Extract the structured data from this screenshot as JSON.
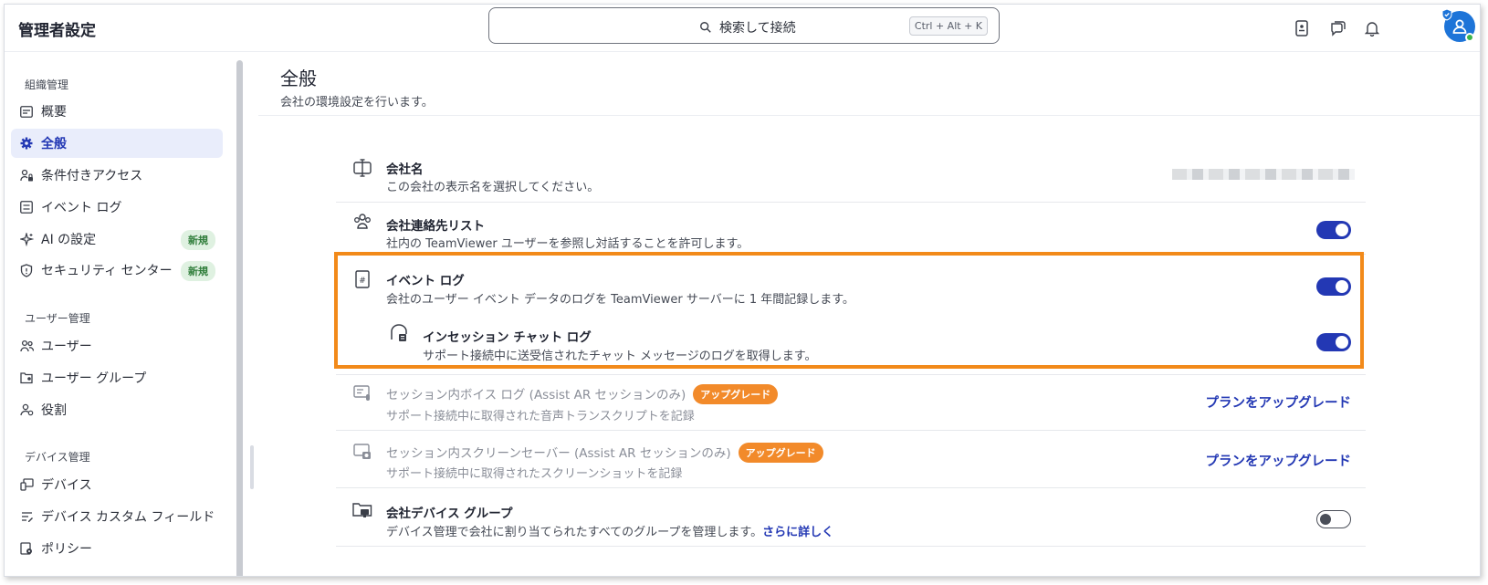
{
  "header": {
    "title": "管理者設定",
    "search_label": "検索して接続",
    "shortcut": "Ctrl + Alt + K"
  },
  "sidebar": {
    "sections": [
      {
        "label": "組織管理",
        "items": [
          {
            "label": "概要",
            "icon": "dashboard-icon"
          },
          {
            "label": "全般",
            "icon": "gear-icon",
            "active": true
          },
          {
            "label": "条件付きアクセス",
            "icon": "conditional-access-icon"
          },
          {
            "label": "イベント ログ",
            "icon": "log-icon"
          },
          {
            "label": "AI の設定",
            "icon": "sparkle-icon",
            "badge": "新規"
          },
          {
            "label": "セキュリティ センター",
            "icon": "shield-icon",
            "badge": "新規"
          }
        ]
      },
      {
        "label": "ユーザー管理",
        "items": [
          {
            "label": "ユーザー",
            "icon": "users-icon"
          },
          {
            "label": "ユーザー グループ",
            "icon": "user-group-icon"
          },
          {
            "label": "役割",
            "icon": "role-icon"
          }
        ]
      },
      {
        "label": "デバイス管理",
        "items": [
          {
            "label": "デバイス",
            "icon": "devices-icon"
          },
          {
            "label": "デバイス カスタム フィールド",
            "icon": "custom-field-icon"
          },
          {
            "label": "ポリシー",
            "icon": "policy-icon"
          }
        ]
      }
    ]
  },
  "main": {
    "title": "全般",
    "subtitle": "会社の環境設定を行います。",
    "settings": [
      {
        "title": "会社名",
        "desc": "この会社の表示名を選択してください。",
        "icon": "company-name-icon"
      },
      {
        "title": "会社連絡先リスト",
        "desc": "社内の TeamViewer ユーザーを参照し対話することを許可します。",
        "icon": "contacts-icon",
        "enabled": true
      },
      {
        "title": "イベント ログ",
        "desc": "会社のユーザー イベント データのログを TeamViewer サーバーに 1 年間記録します。",
        "icon": "event-log-icon",
        "enabled": true
      },
      {
        "title": "インセッション チャット ログ",
        "desc": "サポート接続中に送受信されたチャット メッセージのログを取得します。",
        "icon": "chat-log-icon",
        "enabled": true
      },
      {
        "title": "セッション内ボイス ログ (Assist AR セッションのみ)",
        "badge": "アップグレード",
        "desc": "サポート接続中に取得された音声トランスクリプトを記録",
        "icon": "voice-log-icon",
        "link": "プランをアップグレード"
      },
      {
        "title": "セッション内スクリーンセーバー (Assist AR セッションのみ)",
        "badge": "アップグレード",
        "desc": "サポート接続中に取得されたスクリーンショットを記録",
        "icon": "screenshot-icon",
        "link": "プランをアップグレード"
      },
      {
        "title": "会社デバイス グループ",
        "desc": "デバイス管理で会社に割り当てられたすべてのグループを管理します。",
        "learn_more": "さらに詳しく",
        "icon": "device-group-icon",
        "enabled": false
      }
    ]
  },
  "colors": {
    "accent": "#2338b4",
    "highlight": "#f28a1a",
    "upgrade": "#f28a2a",
    "new_badge": "#dff1e1"
  }
}
